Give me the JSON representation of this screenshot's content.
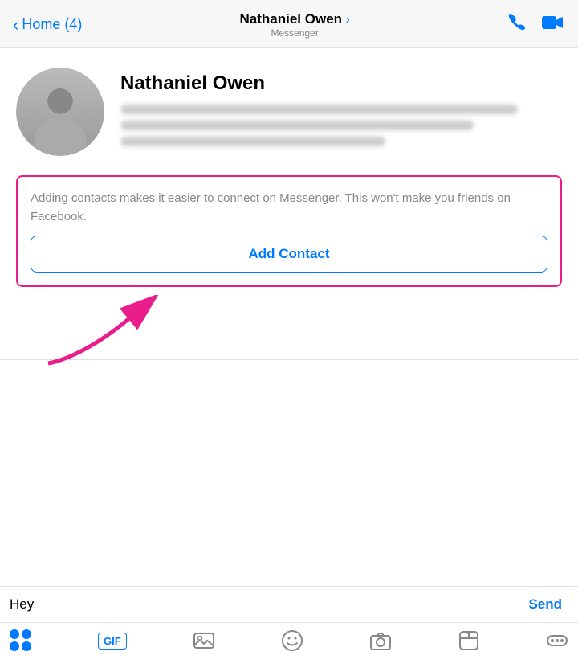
{
  "nav": {
    "back_label": "Home (4)",
    "contact_name": "Nathaniel Owen",
    "chevron": "›",
    "subtitle": "Messenger",
    "phone_icon": "📞",
    "video_icon": "📹"
  },
  "profile": {
    "name": "Nathaniel Owen"
  },
  "contact_box": {
    "description": "Adding contacts makes it easier to connect on Messenger. This won't make you friends on Facebook.",
    "button_label": "Add Contact"
  },
  "input": {
    "text_value": "Hey",
    "cursor": "|",
    "send_label": "Send"
  },
  "toolbar": {
    "gif_label": "GIF",
    "people_label": "people-icon",
    "photo_label": "photo-icon",
    "emoji_label": "emoji-icon",
    "camera_label": "camera-icon",
    "sticker_label": "sticker-icon",
    "more_label": "more-icon"
  }
}
